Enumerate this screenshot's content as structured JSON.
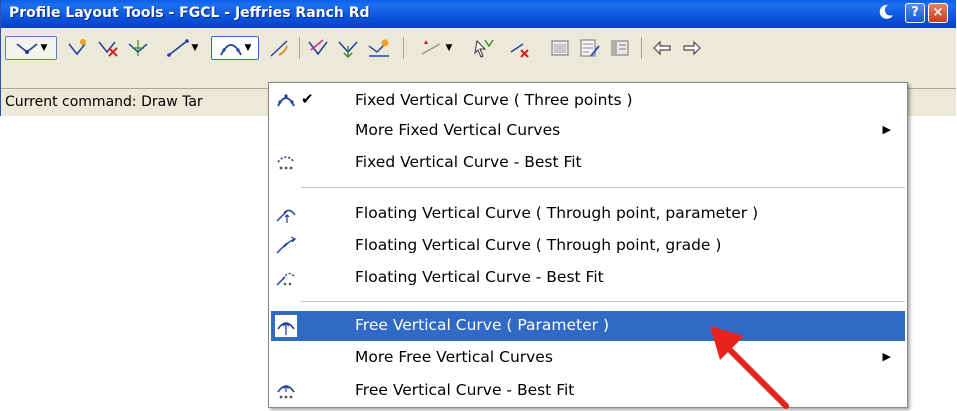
{
  "window": {
    "title": "Profile Layout Tools - FGCL - Jeffries Ranch Rd",
    "help_label": "?",
    "close_label": "×"
  },
  "status": {
    "text": "Current command: Draw Tar"
  },
  "menu": {
    "items": [
      {
        "label": "Fixed Vertical Curve ( Three points )",
        "checked": true,
        "icon": "fixed-curve-three-points-icon"
      },
      {
        "label": "More Fixed Vertical Curves",
        "submenu": true
      },
      {
        "label": "Fixed Vertical Curve - Best Fit",
        "icon": "fixed-curve-best-fit-icon"
      },
      {
        "label": "Floating Vertical Curve ( Through point, parameter )",
        "icon": "floating-curve-parameter-icon"
      },
      {
        "label": "Floating Vertical Curve ( Through point, grade )",
        "icon": "floating-curve-grade-icon"
      },
      {
        "label": "Floating Vertical Curve - Best Fit",
        "icon": "floating-curve-best-fit-icon"
      },
      {
        "label": "Free Vertical Curve ( Parameter )",
        "highlighted": true,
        "icon": "free-curve-parameter-icon"
      },
      {
        "label": "More Free Vertical Curves",
        "submenu": true
      },
      {
        "label": "Free Vertical Curve - Best Fit",
        "icon": "free-curve-best-fit-icon"
      }
    ],
    "check_glyph": "✔",
    "submenu_glyph": "▶"
  },
  "colors": {
    "titlebar": "#0a5fe8",
    "highlight": "#316ac5",
    "annotation_arrow": "#e8231c"
  }
}
